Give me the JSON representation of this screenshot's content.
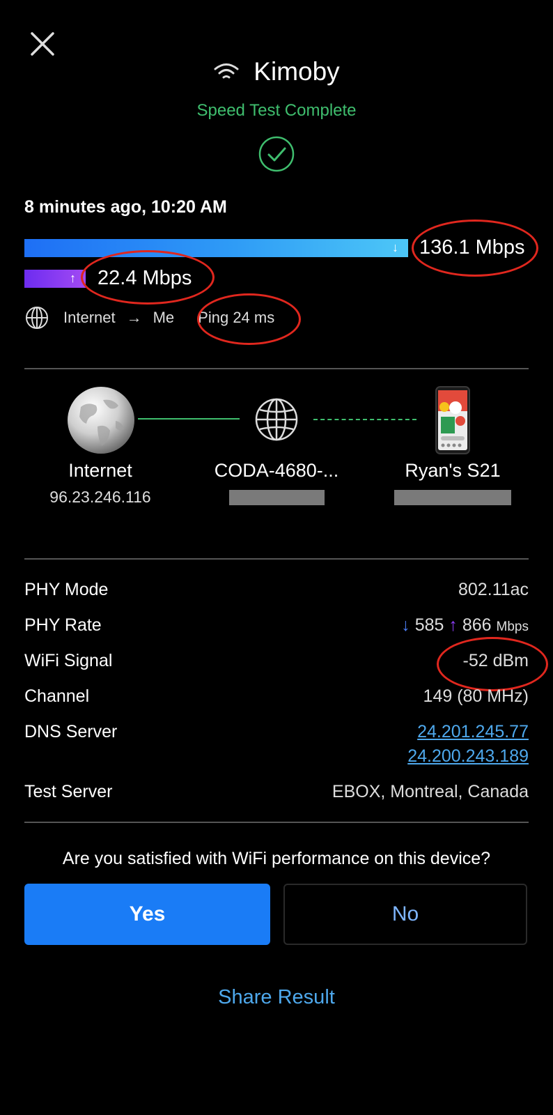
{
  "header": {
    "title": "Kimoby",
    "status": "Speed Test Complete"
  },
  "test": {
    "timestamp": "8 minutes ago, 10:20 AM",
    "download": "136.1 Mbps",
    "upload": "22.4 Mbps",
    "download_fraction_of_track": 1.0,
    "upload_fraction_of_download": 0.16,
    "route_from": "Internet",
    "route_arrow": "→",
    "route_to": "Me",
    "ping": "Ping 24 ms"
  },
  "topology": {
    "internet": {
      "label": "Internet",
      "sub": "96.23.246.116"
    },
    "router": {
      "label": "CODA-4680-..."
    },
    "device": {
      "label": "Ryan's S21"
    }
  },
  "details": {
    "phy_mode": {
      "label": "PHY Mode",
      "value": "802.11ac"
    },
    "phy_rate": {
      "label": "PHY Rate",
      "down_arrow": "↓",
      "down": "585",
      "up_arrow": "↑",
      "up": "866",
      "unit": "Mbps"
    },
    "wifi_signal": {
      "label": "WiFi Signal",
      "value": "-52 dBm"
    },
    "channel": {
      "label": "Channel",
      "value": "149 (80 MHz)"
    },
    "dns": {
      "label": "DNS Server",
      "primary": "24.201.245.77",
      "secondary": "24.200.243.189"
    },
    "test_server": {
      "label": "Test Server",
      "value": "EBOX, Montreal, Canada"
    }
  },
  "feedback": {
    "question": "Are you satisfied with WiFi performance on this device?",
    "yes": "Yes",
    "no": "No"
  },
  "share": "Share Result",
  "colors": {
    "success": "#3fbe6e",
    "download_bar": "#2f9cf6",
    "upload_bar": "#8a3cf2",
    "primary_button": "#1a7cf6",
    "link": "#4ea8ec",
    "annotation_ring": "#e0271e"
  }
}
